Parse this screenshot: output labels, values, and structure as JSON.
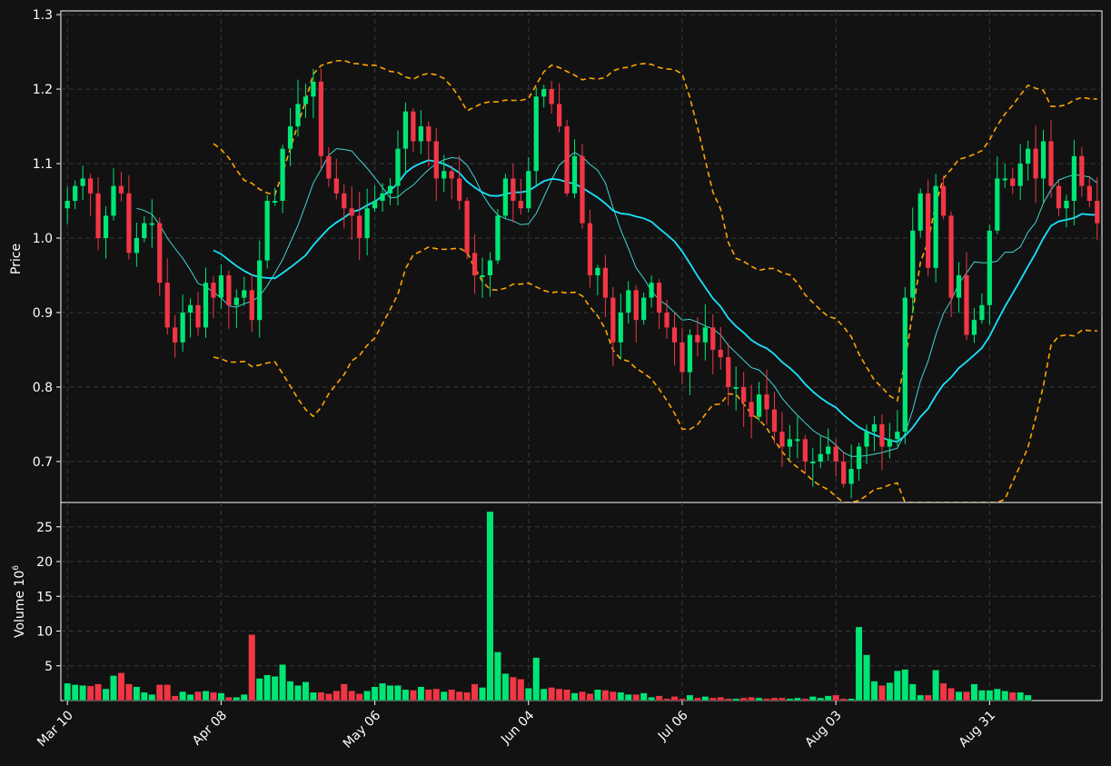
{
  "chart_data": [
    {
      "type": "candlestick",
      "ylabel": "Price",
      "ylim": [
        0.645,
        1.305
      ],
      "yticks": [
        "0.7",
        "0.8",
        "0.9",
        "1.0",
        "1.1",
        "1.2",
        "1.3"
      ],
      "ytick_values": [
        0.7,
        0.8,
        0.9,
        1.0,
        1.1,
        1.2,
        1.3
      ],
      "x_tick_labels": [
        "Mar 10",
        "Apr 08",
        "May 06",
        "Jun 04",
        "Jul 06",
        "Aug 03",
        "Aug 31"
      ],
      "x_tick_index": [
        0,
        20,
        40,
        60,
        80,
        100,
        120
      ],
      "grid": true,
      "colors": {
        "up": "#00e676",
        "down": "#f23645",
        "sma_thick": "#18e4ff",
        "sma_thin": "#3fd6d0",
        "bands": "#ffa500",
        "background": "#121212",
        "grid": "#3a3a3a",
        "axis": "#ffffff"
      },
      "ohlc_close": [
        1.05,
        1.07,
        1.08,
        1.06,
        1.0,
        1.03,
        1.07,
        1.06,
        0.98,
        1.0,
        1.02,
        1.02,
        0.94,
        0.88,
        0.86,
        0.9,
        0.91,
        0.88,
        0.94,
        0.92,
        0.95,
        0.91,
        0.92,
        0.93,
        0.89,
        0.97,
        1.05,
        1.05,
        1.12,
        1.15,
        1.18,
        1.19,
        1.21,
        1.11,
        1.08,
        1.06,
        1.04,
        1.03,
        1.0,
        1.04,
        1.05,
        1.06,
        1.07,
        1.12,
        1.17,
        1.13,
        1.15,
        1.13,
        1.08,
        1.09,
        1.08,
        1.05,
        0.98,
        0.95,
        0.95,
        0.97,
        1.03,
        1.08,
        1.05,
        1.04,
        1.09,
        1.19,
        1.2,
        1.18,
        1.15,
        1.06,
        1.11,
        1.02,
        0.95,
        0.96,
        0.92,
        0.86,
        0.9,
        0.93,
        0.89,
        0.92,
        0.94,
        0.9,
        0.88,
        0.86,
        0.82,
        0.87,
        0.86,
        0.88,
        0.85,
        0.84,
        0.8,
        0.8,
        0.78,
        0.76,
        0.79,
        0.77,
        0.74,
        0.72,
        0.73,
        0.73,
        0.7,
        0.7,
        0.71,
        0.72,
        0.7,
        0.67,
        0.69,
        0.72,
        0.74,
        0.75,
        0.72,
        0.73,
        0.74,
        0.92,
        1.01,
        1.06,
        0.96,
        1.07,
        1.03,
        0.92,
        0.95,
        0.87,
        0.89,
        0.91,
        1.01,
        1.08,
        1.08,
        1.07,
        1.1,
        1.12,
        1.08,
        1.13,
        1.07,
        1.04,
        1.05,
        1.11,
        1.07,
        1.05,
        1.02
      ],
      "volume_label": "Volume  10",
      "volume_exponent": "6",
      "volume_yticks": [
        "5",
        "10",
        "15",
        "20",
        "25"
      ],
      "volume_tick_values": [
        5,
        10,
        15,
        20,
        25
      ],
      "volume_ylim": [
        0,
        28.5
      ],
      "volume": [
        2.5,
        2.3,
        2.2,
        2.1,
        2.4,
        1.7,
        3.6,
        4.0,
        2.4,
        2.0,
        1.2,
        0.9,
        2.3,
        2.3,
        0.7,
        1.3,
        0.9,
        1.3,
        1.4,
        1.2,
        1.1,
        0.5,
        0.5,
        0.9,
        9.5,
        3.2,
        3.7,
        3.5,
        5.2,
        2.8,
        2.2,
        2.7,
        1.2,
        1.2,
        1.0,
        1.4,
        2.4,
        1.4,
        1.0,
        1.4,
        2.0,
        2.5,
        2.2,
        2.2,
        1.6,
        1.5,
        2.0,
        1.6,
        1.7,
        1.3,
        1.6,
        1.3,
        1.2,
        2.4,
        1.9,
        27.2,
        7.0,
        3.9,
        3.4,
        3.1,
        1.8,
        6.2,
        1.7,
        1.9,
        1.7,
        1.6,
        1.1,
        1.3,
        1.0,
        1.6,
        1.5,
        1.3,
        1.2,
        0.9,
        0.9,
        1.1,
        0.5,
        0.7,
        0.3,
        0.6,
        0.3,
        0.8,
        0.4,
        0.6,
        0.4,
        0.5,
        0.3,
        0.3,
        0.4,
        0.5,
        0.4,
        0.3,
        0.4,
        0.4,
        0.3,
        0.4,
        0.3,
        0.6,
        0.4,
        0.7,
        0.8,
        0.3,
        0.3,
        10.6,
        6.6,
        2.8,
        2.2,
        2.6,
        4.3,
        4.5,
        2.4,
        0.8,
        0.8,
        4.4,
        2.5,
        1.8,
        1.3,
        1.3,
        2.4,
        1.5,
        1.5,
        1.7,
        1.4,
        1.2,
        1.2,
        0.8
      ]
    }
  ]
}
